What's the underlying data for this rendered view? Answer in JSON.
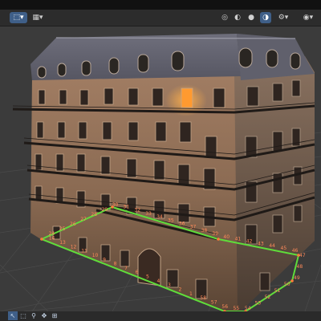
{
  "toolbar": {
    "left_tools": [
      {
        "name": "transform-mode-icon",
        "glyph": "⬚"
      },
      {
        "name": "view-options-icon",
        "glyph": "▦"
      }
    ],
    "shading_modes": [
      {
        "name": "wireframe-shading-icon",
        "glyph": "◎"
      },
      {
        "name": "solid-shading-icon",
        "glyph": "◐"
      },
      {
        "name": "material-shading-icon",
        "glyph": "●"
      },
      {
        "name": "rendered-shading-icon",
        "glyph": "◑"
      }
    ],
    "right_tools": [
      {
        "name": "gizmo-icon",
        "glyph": "⚙"
      },
      {
        "name": "overlay-icon",
        "glyph": "◉"
      }
    ],
    "dropdown_glyph": "▾"
  },
  "viewport": {
    "accent_color": "#4a8ad4",
    "selection_color": "#5fdc3b",
    "vertex_label_color": "#ff8a5a",
    "vertex_labels": [
      "24",
      "25",
      "26",
      "27",
      "28",
      "29",
      "30",
      "31",
      "32",
      "33",
      "34",
      "35",
      "36",
      "37",
      "38",
      "39",
      "40",
      "41",
      "42",
      "43",
      "44",
      "45",
      "46",
      "47",
      "48",
      "49",
      "50",
      "51",
      "52",
      "53",
      "54",
      "55",
      "56",
      "57",
      "58",
      "1",
      "2",
      "3",
      "4",
      "5",
      "6",
      "7",
      "8",
      "9",
      "10",
      "11",
      "12",
      "13",
      "14"
    ]
  },
  "bottom_toolbar": {
    "tools": [
      {
        "name": "select-arrow-icon",
        "glyph": "↖"
      },
      {
        "name": "select-box-icon",
        "glyph": "⬚"
      },
      {
        "name": "zoom-icon",
        "glyph": "⚲"
      },
      {
        "name": "move-icon",
        "glyph": "✥"
      },
      {
        "name": "snap-icon",
        "glyph": "⊞"
      }
    ]
  }
}
